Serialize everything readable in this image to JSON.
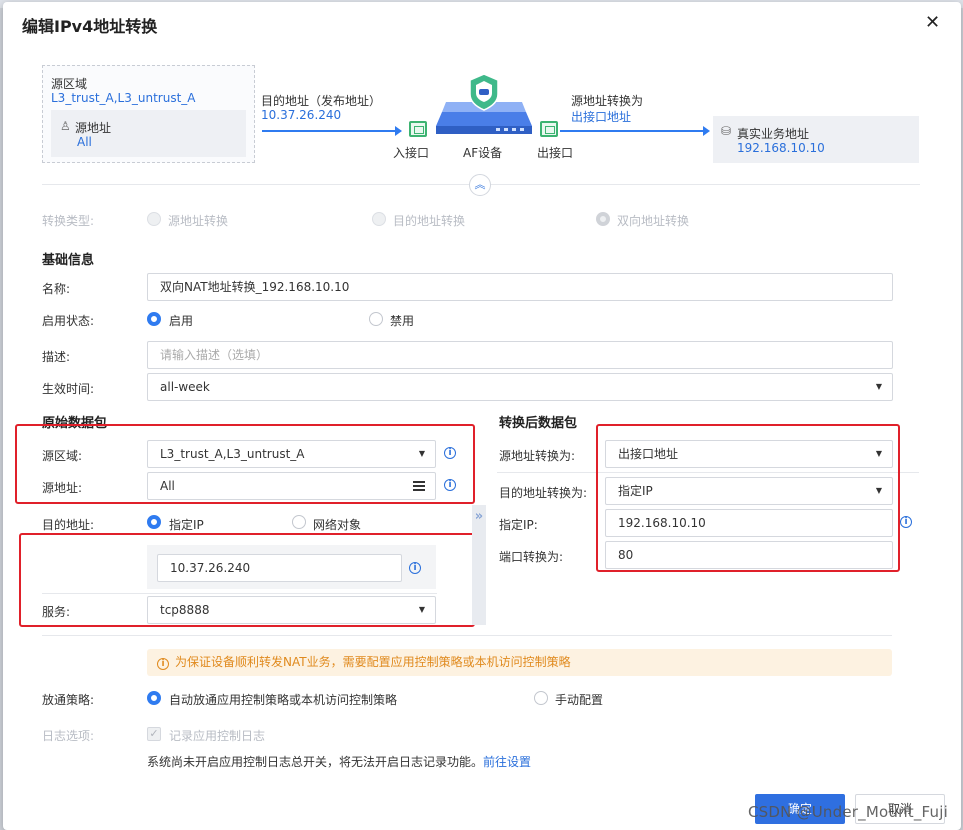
{
  "dialog": {
    "title": "编辑IPv4地址转换",
    "close_icon": "close-icon"
  },
  "topology": {
    "src_zone_label": "源区域",
    "src_zone_value": "L3_trust_A,L3_untrust_A",
    "src_addr_label": "源地址",
    "src_addr_value": "All",
    "dst_addr_label": "目的地址（发布地址）",
    "dst_addr_value": "10.37.26.240",
    "in_port_label": "入接口",
    "device_label": "AF设备",
    "out_port_label": "出接口",
    "src_xlate_label": "源地址转换为",
    "src_xlate_value": "出接口地址",
    "real_addr_label": "真实业务地址",
    "real_addr_value": "192.168.10.10"
  },
  "conversion_type": {
    "label": "转换类型:",
    "options": [
      "源地址转换",
      "目的地址转换",
      "双向地址转换"
    ],
    "selected": "双向地址转换"
  },
  "basic": {
    "section_title": "基础信息",
    "name_label": "名称:",
    "name_value": "双向NAT地址转换_192.168.10.10",
    "status_label": "启用状态:",
    "status_enable": "启用",
    "status_disable": "禁用",
    "desc_label": "描述:",
    "desc_placeholder": "请输入描述（选填）",
    "time_label": "生效时间:",
    "time_value": "all-week"
  },
  "original": {
    "section_title": "原始数据包",
    "src_zone_label": "源区域:",
    "src_zone_value": "L3_trust_A,L3_untrust_A",
    "src_addr_label": "源地址:",
    "src_addr_value": "All",
    "dst_addr_label": "目的地址:",
    "dst_opt_ip": "指定IP",
    "dst_opt_obj": "网络对象",
    "dst_ip_value": "10.37.26.240",
    "service_label": "服务:",
    "service_value": "tcp8888"
  },
  "translated": {
    "section_title": "转换后数据包",
    "src_xlate_label": "源地址转换为:",
    "src_xlate_value": "出接口地址",
    "dst_xlate_label": "目的地址转换为:",
    "dst_xlate_value": "指定IP",
    "ip_label": "指定IP:",
    "ip_value": "192.168.10.10",
    "port_label": "端口转换为:",
    "port_value": "80"
  },
  "warning_text": "为保证设备顺利转发NAT业务，需要配置应用控制策略或本机访问控制策略",
  "policy": {
    "label": "放通策略:",
    "auto": "自动放通应用控制策略或本机访问控制策略",
    "manual": "手动配置"
  },
  "log": {
    "label": "日志选项:",
    "checkbox_label": "记录应用控制日志",
    "note": "系统尚未开启应用控制日志总开关，将无法开启日志记录功能。",
    "link": "前往设置"
  },
  "footer": {
    "ok": "确定",
    "cancel": "取消"
  },
  "watermark": "CSDN @Under_Mount_Fuji"
}
